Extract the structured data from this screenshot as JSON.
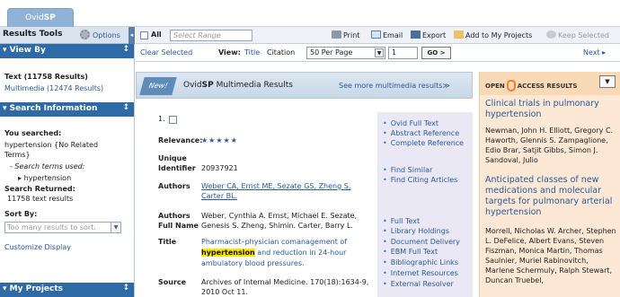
{
  "app": {
    "tab_pre": "Ovid",
    "tab_bold": "SP"
  },
  "sidebar": {
    "results_tools": "Results Tools",
    "options": "Options",
    "view_by": {
      "title": "View By",
      "text_results": "Text (11758 Results)",
      "multimedia_results": "Multimedia (12474 Results)"
    },
    "search_info": {
      "title": "Search Information",
      "you_searched": "You searched:",
      "query": "hypertension {No Related",
      "query2": "Terms}",
      "terms_used": "- Search terms used:",
      "term": "hypertension",
      "returned_label": "Search Returned:",
      "returned_value": "11758 text results",
      "sort_label": "Sort By:",
      "sort_value": "Too many results to sort.",
      "customize": "Customize Display"
    },
    "my_projects": {
      "title": "My Projects"
    }
  },
  "toolbar": {
    "all": "All",
    "range_placeholder": "Select Range",
    "print": "Print",
    "email": "Email",
    "export": "Export",
    "add_projects": "Add to My Projects",
    "keep": "Keep Selected",
    "clear": "Clear Selected",
    "view": "View:",
    "view_title": "Title",
    "view_citation": "Citation",
    "per_page": "50 Per Page",
    "page_num": "1",
    "go": "GO >",
    "next": "Next ▸"
  },
  "banner": {
    "new": "New!",
    "title_pre": "Ovid",
    "title_bold": "SP",
    "title_post": " Multimedia Results",
    "more": "See more multimedia results≫"
  },
  "result": {
    "number": "1.",
    "relevance_label": "Relevance:",
    "stars": "★★★★★",
    "unique_label": "Unique",
    "identifier_label": "Identifier",
    "identifier_value": "20937921",
    "authors_label": "Authors",
    "authors_line1": "Weber CA, Ernst ME, Sezate GS, Zheng S,",
    "authors_line2": "Carter BL.",
    "fullname_label1": "Authors",
    "fullname_label2": "Full Name",
    "fullname_line1": "Weber, Cynthia A. Ernst, Michael E. Sezate,",
    "fullname_line2": "Genesis S. Zheng, Shimin. Carter, Barry L.",
    "title_label": "Title",
    "title_line1": "Pharmacist–physician comanagement of",
    "title_hl": "hypertension",
    "title_line2_rest": " and reduction in 24-hour",
    "title_line3": "ambulatory blood pressures.",
    "source_label": "Source",
    "source_line1": "Archives of Internal Medicine. 170(18):1634-9,",
    "source_line2": "2010 Oct 11."
  },
  "links": [
    "Ovid Full Text",
    "Abstract Reference",
    "Complete Reference",
    "Find Similar",
    "Find Citing Articles",
    "Full Text",
    "Library Holdings",
    "Document Delivery",
    "EBM Full Text",
    "Bibliographic Links",
    "Internet Resources",
    "External Resolver"
  ],
  "open_access": {
    "label_pre": "OPEN",
    "label_post": "ACCESS RESULTS",
    "items": [
      {
        "title": "Clinical trials in pulmonary hypertension",
        "authors": "Newman, John H. Elliott, Gregory C. Haworth, Glennis S. Zampaglione, Edio Brar, Satjit Gibbs, Simon J. Sandoval, Julio"
      },
      {
        "title": "Anticipated classes of new medications and molecular targets for pulmonary arterial hypertension",
        "authors": "Morrell, Nicholas W. Archer, Stephen L. DeFelice, Albert Evans, Steven Fiszman, Monica Martin, Thomas Saulnier, Muriel Rabinovitch, Marlene Schermuly, Ralph Stewart, Duncan Truebel,"
      }
    ]
  },
  "colors": {
    "panel_head": "#2e6aa6",
    "link": "#2a5a9a",
    "oa_bg": "#fce8d4",
    "highlight": "#ffe500"
  }
}
